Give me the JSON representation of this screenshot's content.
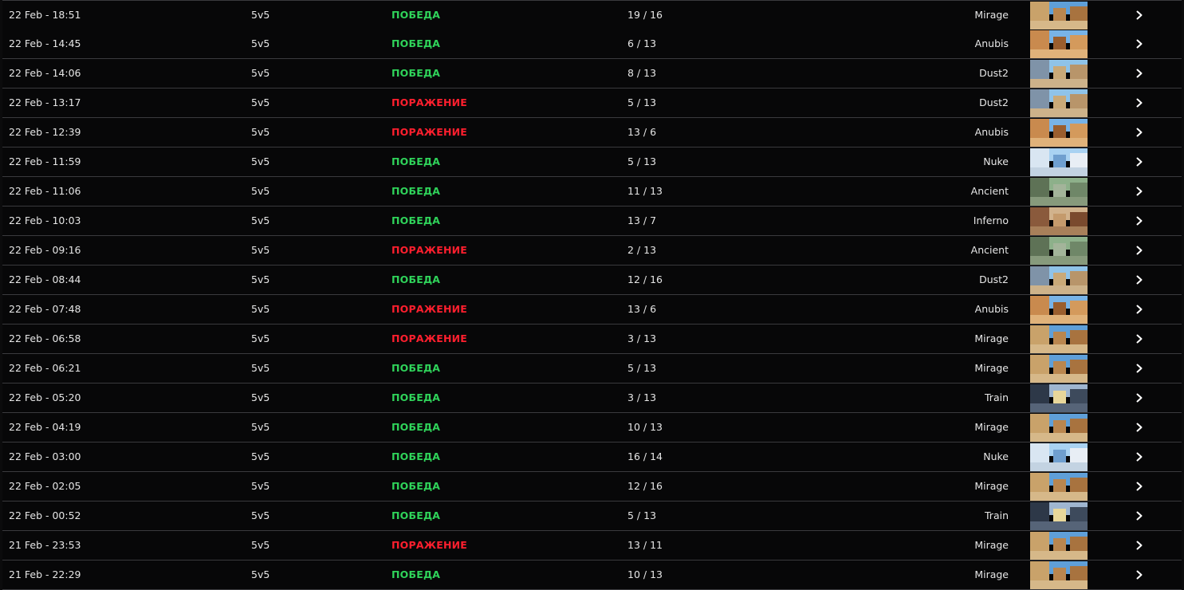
{
  "colors": {
    "win": "#2fd35a",
    "loss": "#ff1f2e",
    "row_bg": "#070708",
    "divider": "#3a3a3d",
    "text": "#e6e6e6"
  },
  "row_action_icon": "chevron-right-icon",
  "matches": [
    {
      "date": "22 Feb - 18:51",
      "mode": "5v5",
      "result": "ПОБЕДА",
      "outcome": "win",
      "score": "19 / 16",
      "map": "Mirage"
    },
    {
      "date": "22 Feb - 14:45",
      "mode": "5v5",
      "result": "ПОБЕДА",
      "outcome": "win",
      "score": "6 / 13",
      "map": "Anubis"
    },
    {
      "date": "22 Feb - 14:06",
      "mode": "5v5",
      "result": "ПОБЕДА",
      "outcome": "win",
      "score": "8 / 13",
      "map": "Dust2"
    },
    {
      "date": "22 Feb - 13:17",
      "mode": "5v5",
      "result": "ПОРАЖЕНИЕ",
      "outcome": "loss",
      "score": "5 / 13",
      "map": "Dust2"
    },
    {
      "date": "22 Feb - 12:39",
      "mode": "5v5",
      "result": "ПОРАЖЕНИЕ",
      "outcome": "loss",
      "score": "13 / 6",
      "map": "Anubis"
    },
    {
      "date": "22 Feb - 11:59",
      "mode": "5v5",
      "result": "ПОБЕДА",
      "outcome": "win",
      "score": "5 / 13",
      "map": "Nuke"
    },
    {
      "date": "22 Feb - 11:06",
      "mode": "5v5",
      "result": "ПОБЕДА",
      "outcome": "win",
      "score": "11 / 13",
      "map": "Ancient"
    },
    {
      "date": "22 Feb - 10:03",
      "mode": "5v5",
      "result": "ПОБЕДА",
      "outcome": "win",
      "score": "13 / 7",
      "map": "Inferno"
    },
    {
      "date": "22 Feb - 09:16",
      "mode": "5v5",
      "result": "ПОРАЖЕНИЕ",
      "outcome": "loss",
      "score": "2 / 13",
      "map": "Ancient"
    },
    {
      "date": "22 Feb - 08:44",
      "mode": "5v5",
      "result": "ПОБЕДА",
      "outcome": "win",
      "score": "12 / 16",
      "map": "Dust2"
    },
    {
      "date": "22 Feb - 07:48",
      "mode": "5v5",
      "result": "ПОРАЖЕНИЕ",
      "outcome": "loss",
      "score": "13 / 6",
      "map": "Anubis"
    },
    {
      "date": "22 Feb - 06:58",
      "mode": "5v5",
      "result": "ПОРАЖЕНИЕ",
      "outcome": "loss",
      "score": "3 / 13",
      "map": "Mirage"
    },
    {
      "date": "22 Feb - 06:21",
      "mode": "5v5",
      "result": "ПОБЕДА",
      "outcome": "win",
      "score": "5 / 13",
      "map": "Mirage"
    },
    {
      "date": "22 Feb - 05:20",
      "mode": "5v5",
      "result": "ПОБЕДА",
      "outcome": "win",
      "score": "3 / 13",
      "map": "Train"
    },
    {
      "date": "22 Feb - 04:19",
      "mode": "5v5",
      "result": "ПОБЕДА",
      "outcome": "win",
      "score": "10 / 13",
      "map": "Mirage"
    },
    {
      "date": "22 Feb - 03:00",
      "mode": "5v5",
      "result": "ПОБЕДА",
      "outcome": "win",
      "score": "16 / 14",
      "map": "Nuke"
    },
    {
      "date": "22 Feb - 02:05",
      "mode": "5v5",
      "result": "ПОБЕДА",
      "outcome": "win",
      "score": "12 / 16",
      "map": "Mirage"
    },
    {
      "date": "22 Feb - 00:52",
      "mode": "5v5",
      "result": "ПОБЕДА",
      "outcome": "win",
      "score": "5 / 13",
      "map": "Train"
    },
    {
      "date": "21 Feb - 23:53",
      "mode": "5v5",
      "result": "ПОРАЖЕНИЕ",
      "outcome": "loss",
      "score": "13 / 11",
      "map": "Mirage"
    },
    {
      "date": "21 Feb - 22:29",
      "mode": "5v5",
      "result": "ПОБЕДА",
      "outcome": "win",
      "score": "10 / 13",
      "map": "Mirage"
    }
  ]
}
